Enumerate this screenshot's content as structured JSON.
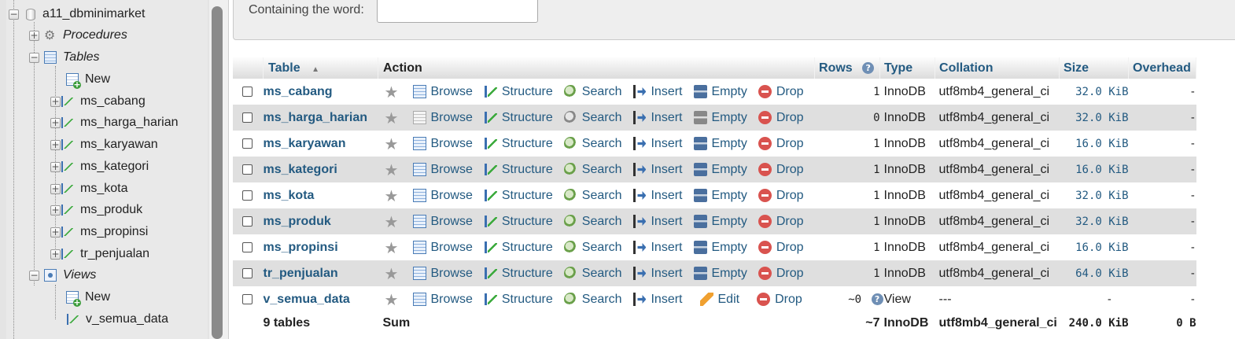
{
  "sidebar": {
    "db_name": "a11_dbminimarket",
    "procedures": "Procedures",
    "tables": "Tables",
    "tables_new": "New",
    "table_items": [
      "ms_cabang",
      "ms_harga_harian",
      "ms_karyawan",
      "ms_kategori",
      "ms_kota",
      "ms_produk",
      "ms_propinsi",
      "tr_penjualan"
    ],
    "views": "Views",
    "views_new": "New",
    "view_items": [
      "v_semua_data"
    ]
  },
  "filter": {
    "label": "Containing the word:",
    "value": ""
  },
  "columns": {
    "table": "Table",
    "action": "Action",
    "rows": "Rows",
    "type": "Type",
    "collation": "Collation",
    "size": "Size",
    "overhead": "Overhead"
  },
  "actions": {
    "browse": "Browse",
    "structure": "Structure",
    "search": "Search",
    "insert": "Insert",
    "empty": "Empty",
    "edit": "Edit",
    "drop": "Drop"
  },
  "rows": [
    {
      "name": "ms_cabang",
      "rows": "1",
      "type": "InnoDB",
      "collation": "utf8mb4_general_ci",
      "size": "32.0 KiB",
      "overhead": "-"
    },
    {
      "name": "ms_harga_harian",
      "rows": "0",
      "type": "InnoDB",
      "collation": "utf8mb4_general_ci",
      "size": "32.0 KiB",
      "overhead": "-"
    },
    {
      "name": "ms_karyawan",
      "rows": "1",
      "type": "InnoDB",
      "collation": "utf8mb4_general_ci",
      "size": "16.0 KiB",
      "overhead": "-"
    },
    {
      "name": "ms_kategori",
      "rows": "1",
      "type": "InnoDB",
      "collation": "utf8mb4_general_ci",
      "size": "16.0 KiB",
      "overhead": "-"
    },
    {
      "name": "ms_kota",
      "rows": "1",
      "type": "InnoDB",
      "collation": "utf8mb4_general_ci",
      "size": "32.0 KiB",
      "overhead": "-"
    },
    {
      "name": "ms_produk",
      "rows": "1",
      "type": "InnoDB",
      "collation": "utf8mb4_general_ci",
      "size": "32.0 KiB",
      "overhead": "-"
    },
    {
      "name": "ms_propinsi",
      "rows": "1",
      "type": "InnoDB",
      "collation": "utf8mb4_general_ci",
      "size": "16.0 KiB",
      "overhead": "-"
    },
    {
      "name": "tr_penjualan",
      "rows": "1",
      "type": "InnoDB",
      "collation": "utf8mb4_general_ci",
      "size": "64.0 KiB",
      "overhead": "-"
    }
  ],
  "view_row": {
    "name": "v_semua_data",
    "rows": "~0",
    "type": "View",
    "collation": "---",
    "size": "-",
    "overhead": "-"
  },
  "footer": {
    "tables": "9 tables",
    "sum": "Sum",
    "rows": "~7",
    "type": "InnoDB",
    "collation": "utf8mb4_general_ci",
    "size": "240.0 KiB",
    "overhead": "0 B"
  }
}
